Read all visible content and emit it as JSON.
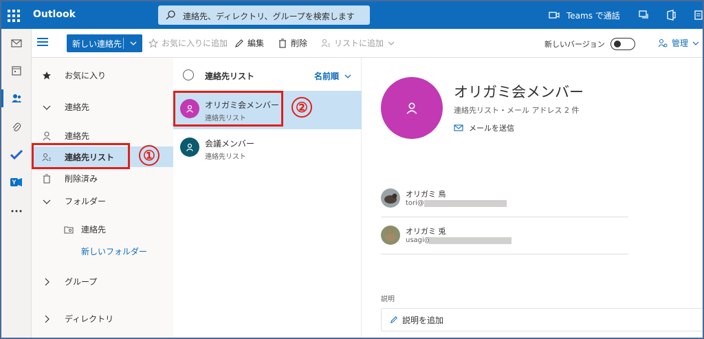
{
  "app": {
    "name": "Outlook",
    "search_placeholder": "連絡先、ディレクトリ、グループを検索します",
    "teams_call": "Teams で通話"
  },
  "toolbar": {
    "new_contact": "新しい連絡先",
    "add_favorite": "お気に入りに追加",
    "edit": "編集",
    "delete": "削除",
    "add_to_list": "リストに追加",
    "new_version": "新しいバージョン",
    "manage": "管理"
  },
  "nav": {
    "favorites": "お気に入り",
    "contacts_header": "連絡先",
    "contacts": "連絡先",
    "contact_lists": "連絡先リスト",
    "deleted": "削除済み",
    "folders": "フォルダー",
    "folder_contacts": "連絡先",
    "new_folder": "新しいフォルダー",
    "groups": "グループ",
    "directory": "ディレクトリ"
  },
  "list": {
    "title": "連絡先リスト",
    "sort": "名前順",
    "items": [
      {
        "name": "オリガミ会メンバー",
        "sub": "連絡先リスト",
        "color": "#c239b3"
      },
      {
        "name": "会議メンバー",
        "sub": "連絡先リスト",
        "color": "#0b5a6e"
      }
    ]
  },
  "detail": {
    "title": "オリガミ会メンバー",
    "subtitle": "連絡先リスト・メール アドレス 2 件",
    "send_mail": "メールを送信",
    "members": [
      {
        "name": "オリガミ 鳥",
        "email_prefix": "tori@"
      },
      {
        "name": "オリガミ 兎",
        "email_prefix": "usagi@"
      }
    ],
    "description_label": "説明",
    "add_description": "説明を追加"
  },
  "annotations": {
    "step1": "①",
    "step2": "②"
  },
  "colors": {
    "accent": "#0f6cbd",
    "highlight": "#c7e0f4",
    "annotation": "#e0201b"
  }
}
